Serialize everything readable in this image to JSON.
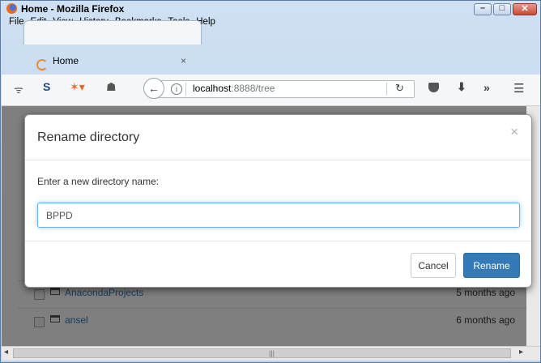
{
  "window": {
    "title": "Home - Mozilla Firefox"
  },
  "menubar": {
    "items": [
      "File",
      "Edit",
      "View",
      "History",
      "Bookmarks",
      "Tools",
      "Help"
    ]
  },
  "tab": {
    "label": "Home",
    "close": "×"
  },
  "urlbar": {
    "host": "localhost",
    "rest": ":8888/tree"
  },
  "toolbar_icons": [
    "rss-icon",
    "s-icon",
    "fox-icon",
    "incognito-icon",
    "back-icon",
    "info-icon",
    "reload-icon",
    "pocket-icon",
    "download-icon",
    "overflow-icon",
    "menu-icon"
  ],
  "modal": {
    "title": "Rename directory",
    "close": "×",
    "label": "Enter a new directory name:",
    "input_value": "BPPD",
    "cancel_label": "Cancel",
    "rename_label": "Rename"
  },
  "file_rows": [
    {
      "name": "AnacondaProjects",
      "modified": "5 months ago"
    },
    {
      "name": "ansel",
      "modified": "6 months ago"
    }
  ],
  "colors": {
    "primary": "#337ab7",
    "link": "#337ab7",
    "focus": "#66afe9"
  }
}
